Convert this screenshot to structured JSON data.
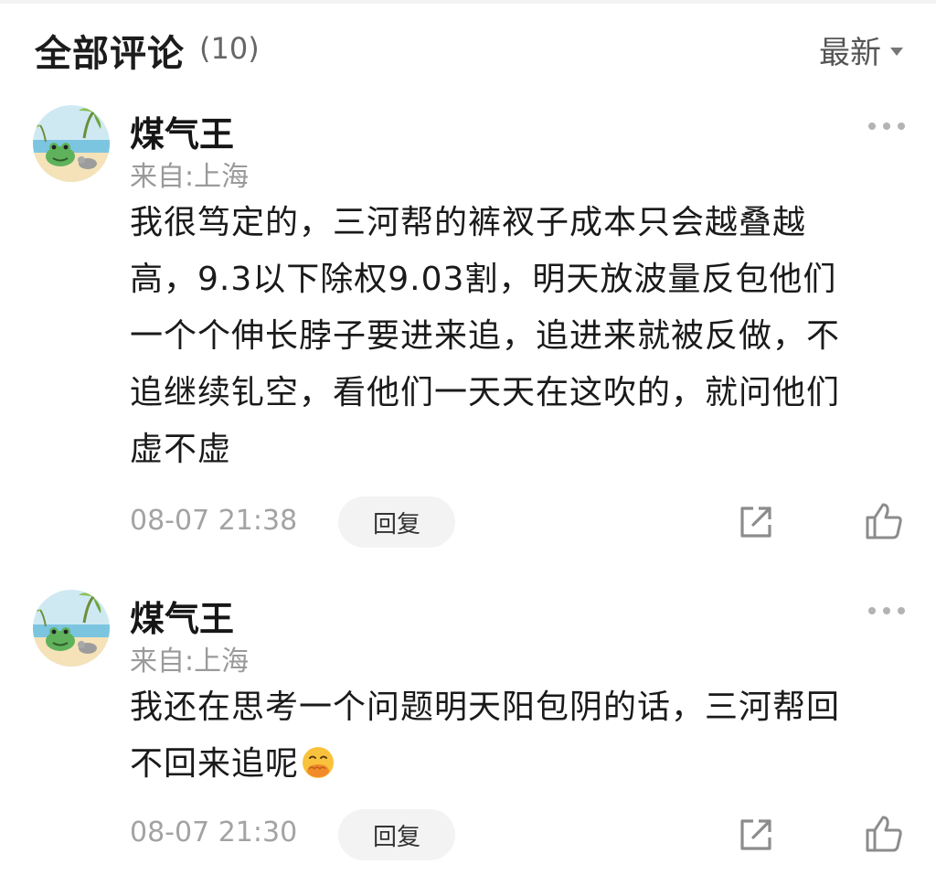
{
  "header": {
    "title": "全部评论",
    "count": "(10)",
    "sort_label": "最新",
    "sort_icon": "caret-down-icon"
  },
  "comments": [
    {
      "author": "煤气王",
      "location": "来自:上海",
      "text_lines": [
        "我很笃定的，三河帮的裤衩子成本只会越叠越",
        "高，9.3以下除权9.03割，明天放波量反包他们",
        "一个个伸长脖子要进来追，追进来就被反做，不",
        "追继续钆空，看他们一天天在这吹的，就问他们",
        "虚不虚"
      ],
      "time": "08-07 21:38",
      "reply_label": "回复",
      "icons": {
        "more": "more-icon",
        "share": "share-icon",
        "like": "thumbs-up-icon"
      }
    },
    {
      "author": "煤气王",
      "location": "来自:上海",
      "text_lines": [
        "我还在思考一个问题明天阳包阴的话，三河帮回",
        "不回来追呢"
      ],
      "emoji": "face-with-hand-over-mouth-emoji",
      "time": "08-07 21:30",
      "reply_label": "回复",
      "icons": {
        "more": "more-icon",
        "share": "share-icon",
        "like": "thumbs-up-icon"
      }
    }
  ],
  "colors": {
    "text": "#1a1a1a",
    "muted": "#9a9a9a",
    "reply_bg": "#f3f3f3",
    "icon": "#8c8c8c"
  }
}
